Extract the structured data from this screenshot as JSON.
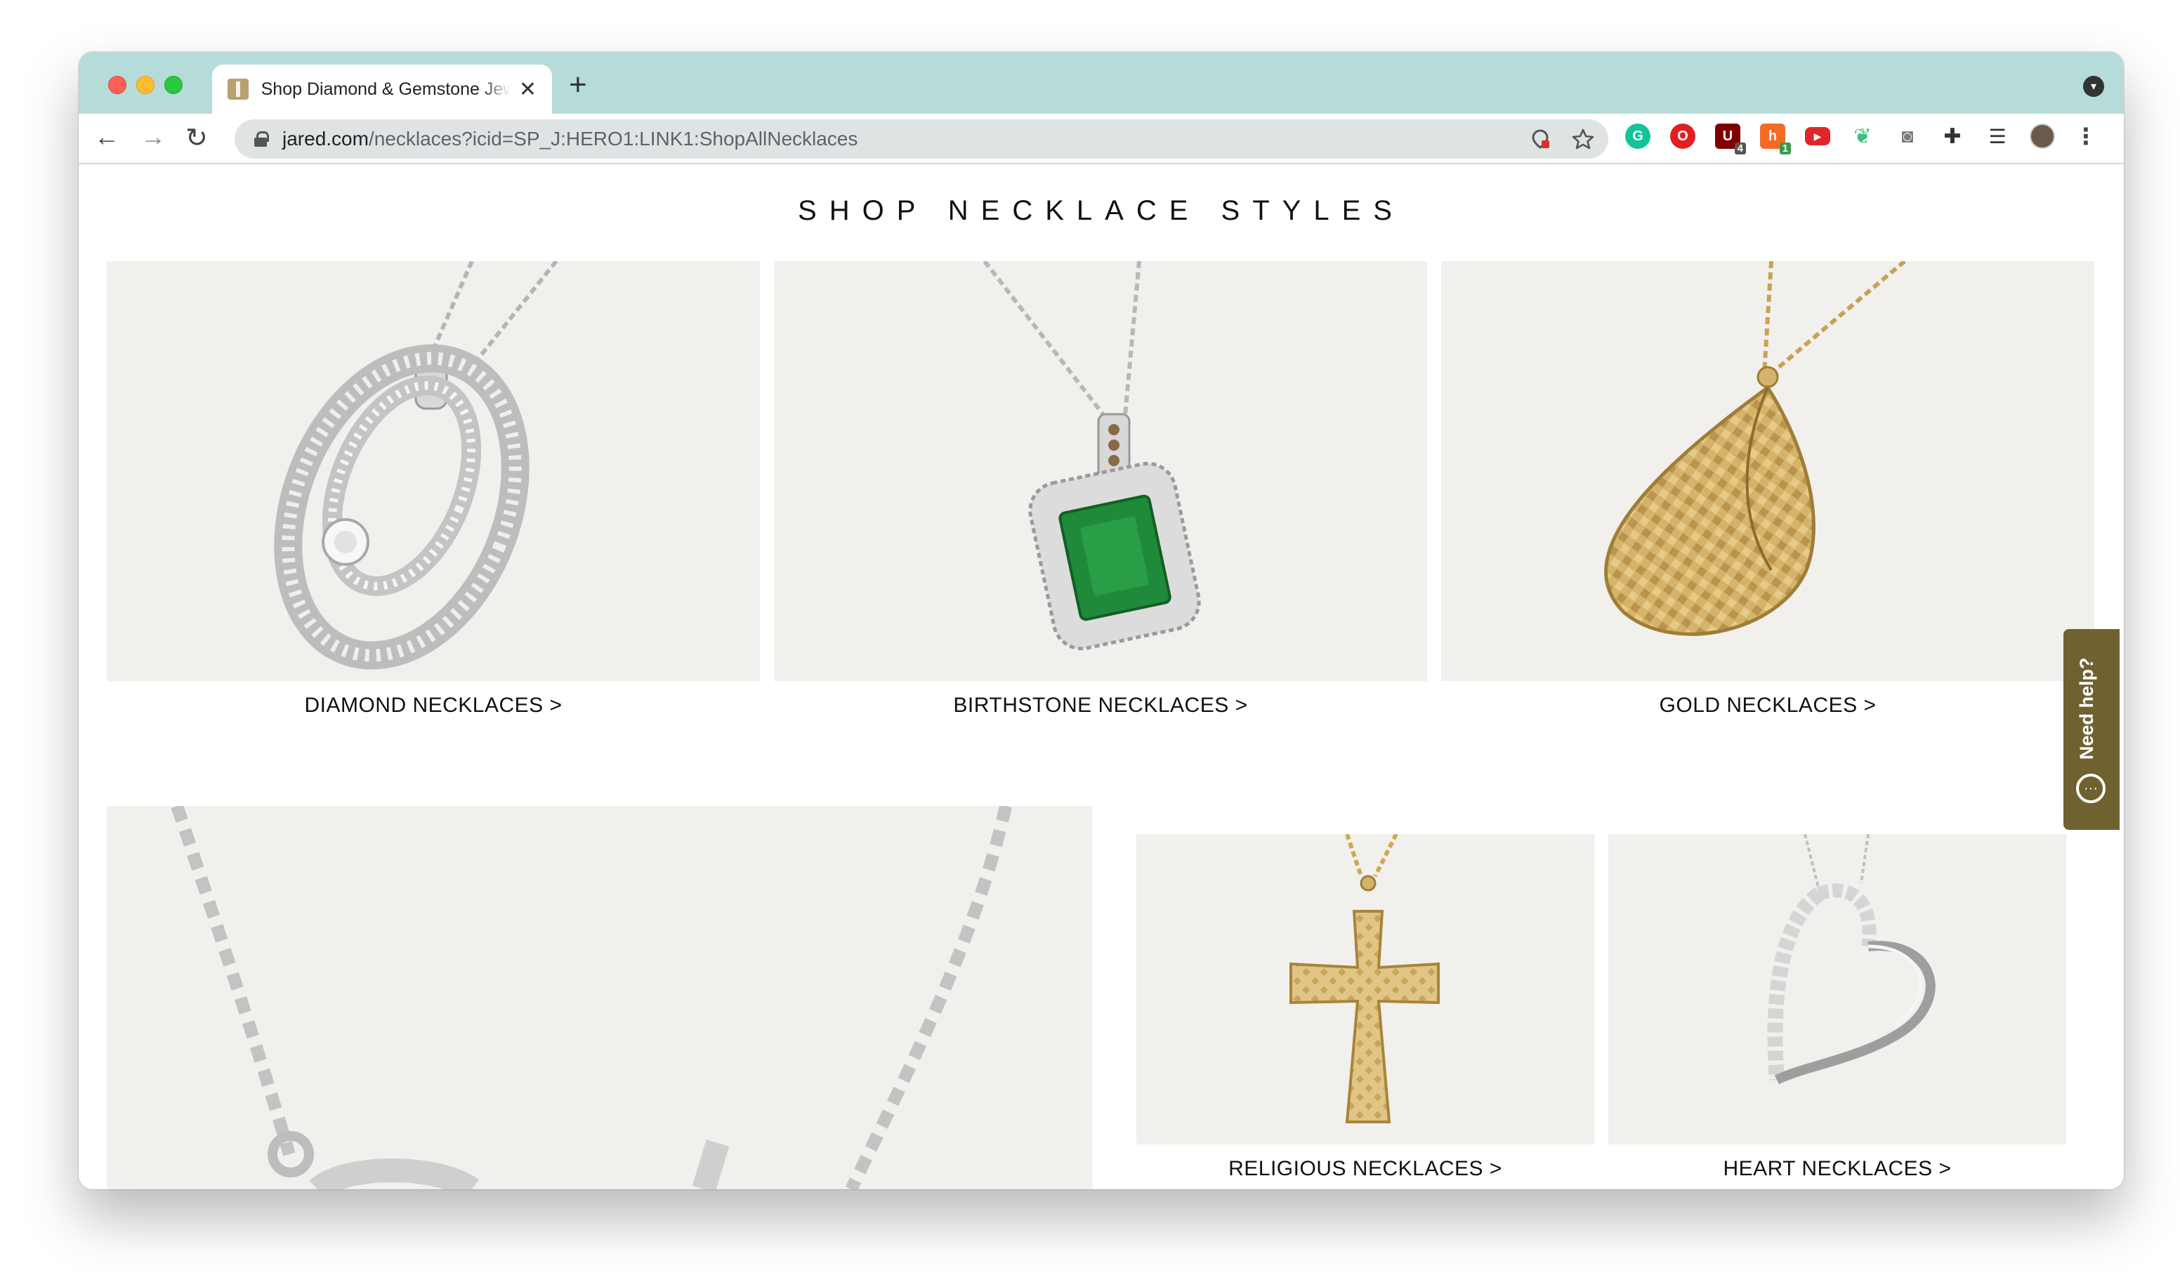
{
  "browser": {
    "tab_title": "Shop Diamond & Gemstone Jewelry",
    "new_tab_symbol": "+",
    "close_symbol": "✕",
    "url_host": "jared.com",
    "url_path": "/necklaces?icid=SP_J:HERO1:LINK1:ShopAllNecklaces",
    "extensions": [
      {
        "name": "grammarly-icon",
        "color": "#15c39a",
        "badge": ""
      },
      {
        "name": "opera-adblock-icon",
        "color": "#e02020",
        "badge": ""
      },
      {
        "name": "ublock-icon",
        "color": "#800000",
        "badge": "4"
      },
      {
        "name": "honey-icon",
        "color": "#f26c25",
        "badge": "1"
      },
      {
        "name": "youtube-icon",
        "color": "#e0262a",
        "badge": ""
      },
      {
        "name": "leaf-extension-icon",
        "color": "#3fbf7f",
        "badge": ""
      },
      {
        "name": "camera-icon",
        "color": "#7a7a7a",
        "badge": ""
      },
      {
        "name": "extensions-puzzle-icon",
        "color": "#333333",
        "badge": ""
      },
      {
        "name": "reading-list-icon",
        "color": "#333333",
        "badge": ""
      }
    ]
  },
  "page": {
    "section_title": "SHOP NECKLACE STYLES",
    "cards": [
      {
        "label": "DIAMOND NECKLACES >"
      },
      {
        "label": "BIRTHSTONE NECKLACES >"
      },
      {
        "label": "GOLD NECKLACES >"
      },
      {
        "label": "RELIGIOUS NECKLACES >"
      },
      {
        "label": "HEART NECKLACES >"
      }
    ],
    "need_help": "Need help?",
    "scroll_top_symbol": "⌃"
  },
  "colors": {
    "tabbar": "#b6dcd9",
    "card_bg": "#f1f0ed",
    "need_help_bg": "#6f6230",
    "gold": "#d4b46a",
    "silver": "#c9c9c9",
    "emerald": "#1e8a3a"
  }
}
